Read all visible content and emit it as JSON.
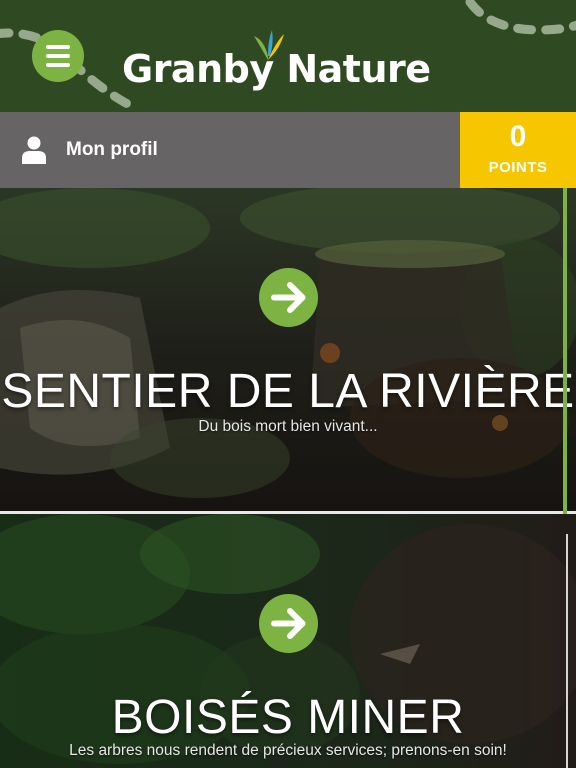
{
  "header": {
    "brand_name": "Granby Nature",
    "menu_icon": "hamburger-menu-icon",
    "logo_icon": "leaf-sprout-icon",
    "colors": {
      "header_bg": "#2f4a22",
      "accent_green": "#7cb342"
    }
  },
  "profile": {
    "label": "Mon profil",
    "icon": "user-icon",
    "bg_color": "#666464"
  },
  "points": {
    "value": "0",
    "label": "POINTS",
    "bg_color": "#f6c700"
  },
  "trails": [
    {
      "title": "SENTIER DE LA RIVIÈRE",
      "subtitle": "Du bois mort bien vivant...",
      "icon": "arrow-right-icon"
    },
    {
      "title": "BOISÉS MINER",
      "subtitle": "Les arbres nous rendent de précieux services; prenons-en soin!",
      "icon": "arrow-right-icon"
    }
  ]
}
